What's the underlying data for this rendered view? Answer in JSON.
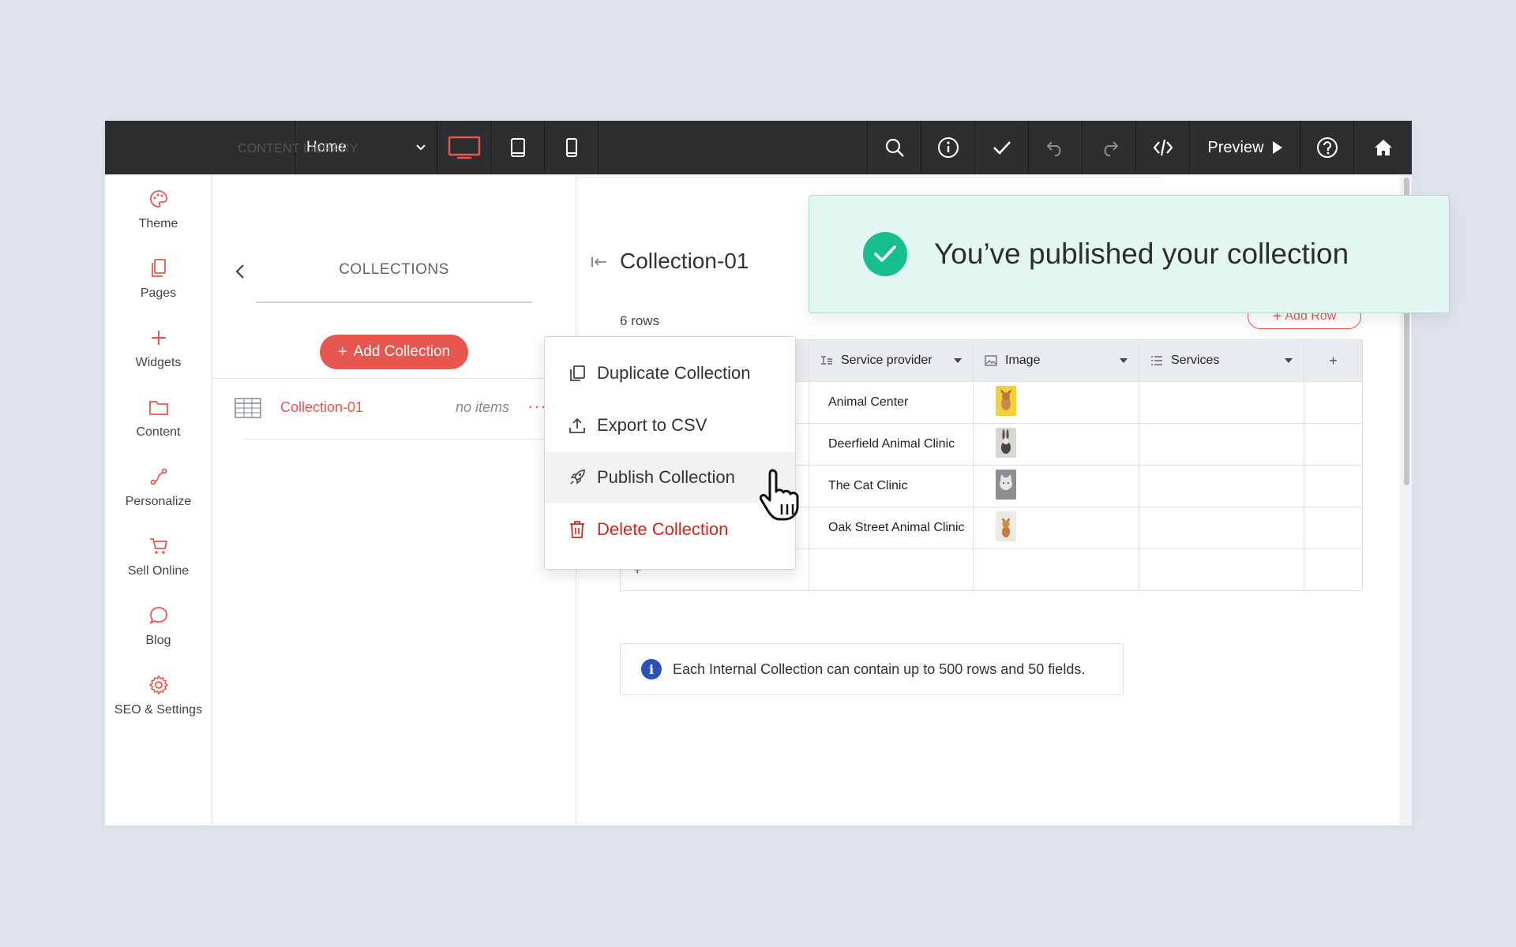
{
  "topbar": {
    "page_select": "Home",
    "preview_label": "Preview"
  },
  "sidebar": {
    "items": [
      {
        "label": "Theme",
        "icon": "palette-icon"
      },
      {
        "label": "Pages",
        "icon": "pages-icon"
      },
      {
        "label": "Widgets",
        "icon": "plus-icon"
      },
      {
        "label": "Content",
        "icon": "folder-icon"
      },
      {
        "label": "Personalize",
        "icon": "path-icon"
      },
      {
        "label": "Sell Online",
        "icon": "cart-icon"
      },
      {
        "label": "Blog",
        "icon": "chat-bubble-icon"
      },
      {
        "label": "SEO & Settings",
        "icon": "gear-icon"
      }
    ],
    "accent": "#e8574f"
  },
  "content_library": {
    "header": "CONTENT LIBRARY",
    "collections_title": "COLLECTIONS",
    "add_collection": "Add Collection",
    "collection": {
      "name": "Collection-01",
      "items": "no items",
      "more": "···"
    }
  },
  "main": {
    "title": "Collection-01",
    "rows_count": "6 rows",
    "add_row": "Add Row",
    "columns": [
      "Service provider",
      "Image",
      "Services",
      "+"
    ],
    "rows": [
      {
        "provider": "Animal Center",
        "image": "dog-photo"
      },
      {
        "provider": "Deerfield Animal Clinic",
        "image": "rabbit-photo"
      },
      {
        "provider": "The Cat Clinic",
        "image": "cat-photo"
      },
      {
        "provider": "Oak Street Animal Clinic",
        "image": "puppy-photo"
      }
    ],
    "add_row_plus": "+",
    "info": "Each Internal Collection can contain up to 500 rows and 50 fields."
  },
  "menu": {
    "items": [
      {
        "label": "Duplicate Collection",
        "icon": "duplicate-icon"
      },
      {
        "label": "Export to CSV",
        "icon": "upload-icon"
      },
      {
        "label": "Publish Collection",
        "icon": "rocket-icon"
      },
      {
        "label": "Delete Collection",
        "icon": "trash-icon"
      }
    ]
  },
  "toast": {
    "message": "You’ve published your collection",
    "color": "#17c08a"
  }
}
